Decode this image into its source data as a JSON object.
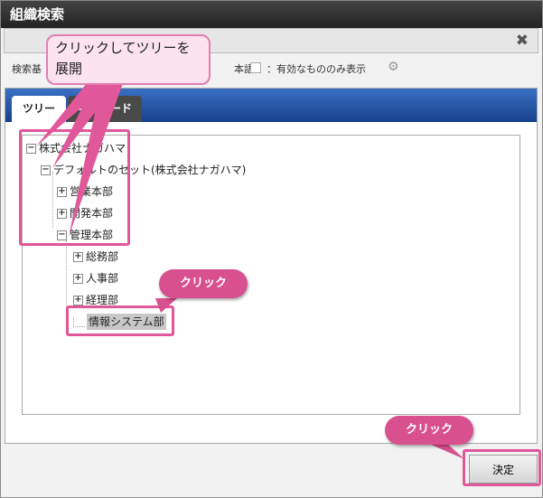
{
  "window": {
    "title": "組織検索"
  },
  "conditions": {
    "label": "検索基",
    "lang_label": "本語",
    "valid_only_label": "：有効なもののみ表示",
    "valid_only_checked": false,
    "icon": "gear-icon"
  },
  "tabs": [
    {
      "label": "ツリー",
      "active": true
    },
    {
      "label": "キーワード",
      "active": false
    }
  ],
  "tree": {
    "root": "株式会社ナガハマ",
    "set": "デフォルトのセット(株式会社ナガハマ)",
    "departments": [
      "営業本部",
      "開発本部",
      "管理本部"
    ],
    "children": [
      "総務部",
      "人事部",
      "経理部"
    ],
    "selected": "情報システム部"
  },
  "annotations": {
    "expand_callout": "クリックしてツリーを展開",
    "click1": "クリック",
    "click2": "クリック",
    "highlight_color": "#e0579a"
  },
  "footer": {
    "decide_label": "決定"
  }
}
